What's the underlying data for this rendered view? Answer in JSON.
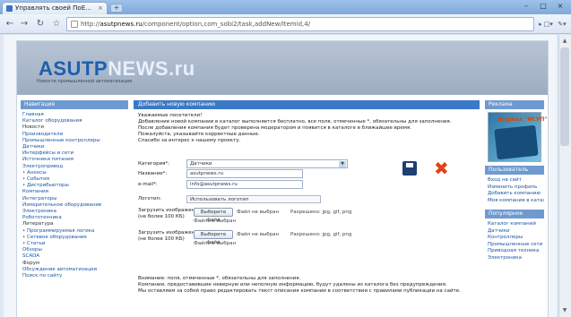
{
  "browser": {
    "tab_title": "Управлять своей ПоЕ...",
    "tab_close": "×",
    "new_tab": "+",
    "url_prefix": "http://",
    "url_host": "asutpnews.ru",
    "url_path": "/component/option,com_sobi2/task,addNew/Itemid,4/",
    "window_min": "–",
    "window_max": "□",
    "window_close": "×",
    "nav": {
      "back": "←",
      "forward": "→",
      "reload": "↻",
      "home": "☆"
    },
    "menu_page": "▸ □▾",
    "menu_tools": "✎▾"
  },
  "site": {
    "logo_main": "ASUTP",
    "logo_accent": "NEWS.ru",
    "logo_tagline": "Новости промышленной автоматизации"
  },
  "left": {
    "heading": "Навигация",
    "items": [
      {
        "text": "Главная",
        "cat": false
      },
      {
        "text": "Каталог оборудования",
        "cat": false
      },
      {
        "text": "Новости",
        "cat": true
      },
      {
        "text": "Производители",
        "cat": false
      },
      {
        "text": "Промышленные контроллеры",
        "cat": false
      },
      {
        "text": "Датчики",
        "cat": false
      },
      {
        "text": "Интерфейсы и сети",
        "cat": false
      },
      {
        "text": "Источники питания",
        "cat": false
      },
      {
        "text": "Электропривод",
        "cat": false
      },
      {
        "text": "• Анонсы",
        "cat": false
      },
      {
        "text": "• События",
        "cat": false
      },
      {
        "text": "• Дистрибьюторы",
        "cat": false
      },
      {
        "text": "Компании",
        "cat": false
      },
      {
        "text": "Интеграторы",
        "cat": false
      },
      {
        "text": "Измерительное оборудование",
        "cat": false
      },
      {
        "text": "Электроника",
        "cat": false
      },
      {
        "text": "Робототехника",
        "cat": false
      },
      {
        "text": "Литература",
        "cat": true
      },
      {
        "text": "• Программируемая логика",
        "cat": false
      },
      {
        "text": "• Сетевое оборудование",
        "cat": false
      },
      {
        "text": "• Статьи",
        "cat": false
      },
      {
        "text": "Обзоры",
        "cat": false
      },
      {
        "text": "SCADA",
        "cat": false
      },
      {
        "text": "Форум",
        "cat": true
      },
      {
        "text": "Обсуждение автоматизации",
        "cat": false
      },
      {
        "text": "Поиск по сайту",
        "cat": false
      }
    ]
  },
  "center": {
    "heading": "Добавить новую компанию",
    "intro": [
      "Уважаемые посетители!",
      "Добавление новой компании в каталог выполняется бесплатно, все поля, отмеченные *, обязательны для заполнения.",
      "После добавления компания будет проверена модератором и появится в каталоге в ближайшее время.",
      "Пожалуйста, указывайте корректные данные.",
      "Спасибо за интерес к нашему проекту."
    ],
    "form": {
      "category_label": "Категория*:",
      "category_value": "Датчики",
      "name_label": "Название*:",
      "name_value": "asutpnews.ru",
      "email_label": "e-mail*:",
      "email_value": "info@asutpnews.ru",
      "logo_label": "Логотип:",
      "logo_check": "Использовать логотип",
      "file1_label": "Загрузить изображение",
      "file1_sub": "(не более 100 КБ)",
      "file_button": "Выберите файл",
      "file_none": "Файл не выбран",
      "file_note": "Разрешено: jpg, gif, png",
      "file1_name": "Файл не выбран",
      "file2_label": "Загрузить изображение",
      "file2_sub": "(не более 100 КБ)",
      "file2_name": "Файл не выбран"
    },
    "footnote": [
      "Внимание: поля, отмеченные *, обязательны для заполнения.",
      "Компании, предоставившие неверную или неполную информацию, будут удалены из каталога без предупреждения.",
      "Мы оставляем за собой право редактировать текст описания компании в соответствии с правилами публикации на сайте."
    ]
  },
  "right": {
    "heading1": "Реклама",
    "banner_title": "Журнал \"ИСУП\"",
    "heading2": "Пользователь",
    "user_links": [
      "Вход на сайт",
      "Изменить профиль",
      "Добавить компанию",
      "Моя компания в каталоге"
    ],
    "heading3": "Популярное",
    "popular": [
      "Каталог компаний",
      "Датчики",
      "Контроллеры",
      "Промышленные сети",
      "Приводная техника",
      "Электроника"
    ]
  }
}
